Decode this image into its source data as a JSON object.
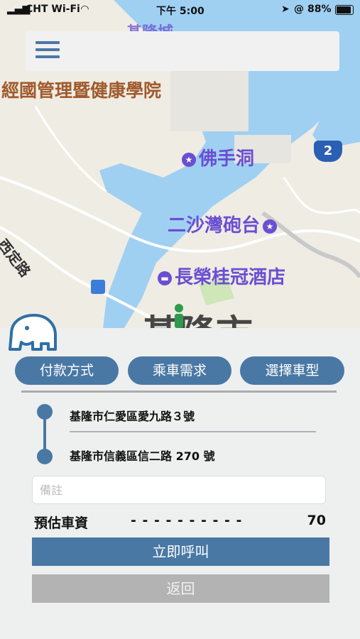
{
  "status_bar": {
    "carrier": "CHT Wi-Fi",
    "time": "下午 5:00",
    "battery": "88%"
  },
  "map": {
    "labels": {
      "top_partial": "基隆城",
      "institute": "經國管理暨健康學院",
      "cave": "佛手洞",
      "fort": "二沙灣砲台",
      "hotel": "長榮桂冠酒店",
      "street": "西定路",
      "city": "基隆市",
      "highway": "2"
    }
  },
  "tabs": {
    "payment": "付款方式",
    "ride": "乘車需求",
    "vehicle": "選擇車型"
  },
  "route": {
    "pickup": "基隆市仁愛區愛九路３號",
    "dropoff": "基隆市信義區信二路 270 號"
  },
  "note": {
    "placeholder": "備註",
    "value": ""
  },
  "fare": {
    "label": "預估車資",
    "dashes": "- - - - - - - - - -",
    "value": "70"
  },
  "buttons": {
    "call": "立即呼叫",
    "back": "返回"
  }
}
